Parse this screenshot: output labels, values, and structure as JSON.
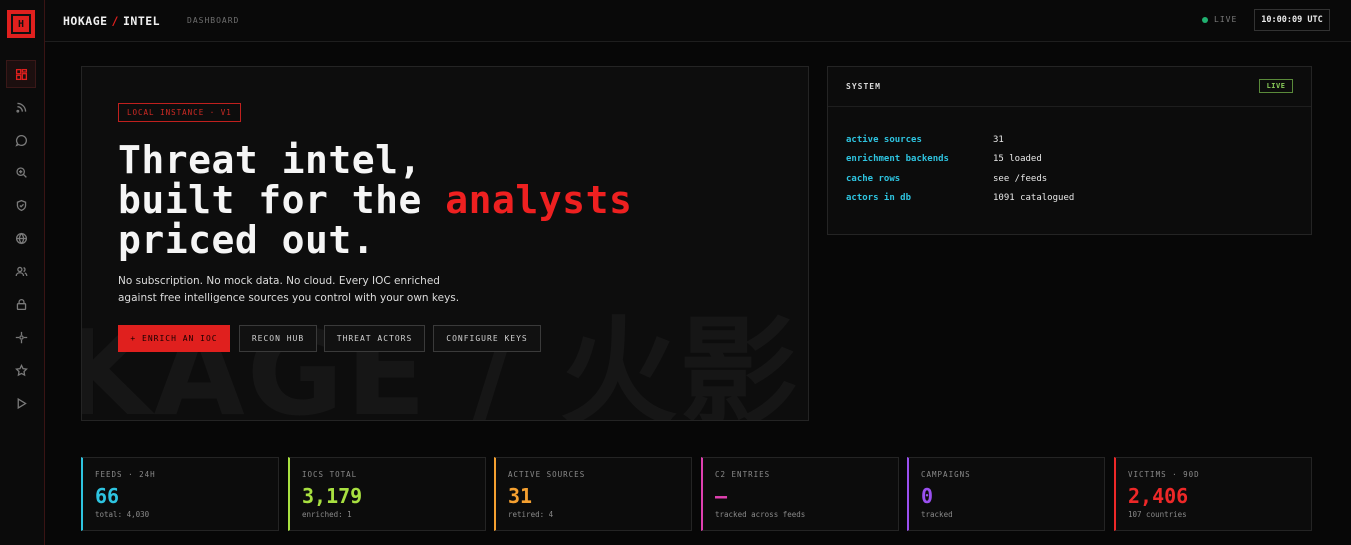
{
  "brand": {
    "logo_letter": "H",
    "left": "HOKAGE",
    "sep": "/",
    "right": "INTEL"
  },
  "breadcrumb": "DASHBOARD",
  "status": {
    "live_label": "LIVE",
    "clock": "10:00:09 UTC"
  },
  "sidebar": {
    "items": [
      {
        "icon": "dashboard-icon",
        "active": true
      },
      {
        "icon": "rss-feed-icon"
      },
      {
        "icon": "chat-bubble-icon"
      },
      {
        "icon": "search-zoom-icon"
      },
      {
        "icon": "shield-check-icon"
      },
      {
        "icon": "globe-icon"
      },
      {
        "icon": "users-icon"
      },
      {
        "icon": "lock-icon"
      },
      {
        "icon": "crosshair-icon"
      },
      {
        "icon": "star-icon"
      },
      {
        "icon": "play-icon"
      }
    ]
  },
  "hero": {
    "badge": "LOCAL INSTANCE · V1",
    "title_line1": "Threat intel,",
    "title_line2_pre": "built for the ",
    "title_line2_accent": "analysts",
    "title_line3": "priced out.",
    "description": "No subscription. No mock data. No cloud. Every IOC enriched against free intelligence sources you control with your own keys.",
    "watermark": "KAGE / 火影",
    "buttons": {
      "enrich": "+ ENRICH AN IOC",
      "recon": "RECON HUB",
      "actors": "THREAT ACTORS",
      "keys": "CONFIGURE KEYS"
    }
  },
  "system": {
    "title": "SYSTEM",
    "badge": "LIVE",
    "rows": [
      {
        "key": "active sources",
        "value": "31"
      },
      {
        "key": "enrichment backends",
        "value": "15 loaded"
      },
      {
        "key": "cache rows",
        "value": "see /feeds"
      },
      {
        "key": "actors in db",
        "value": "1091 catalogued"
      }
    ]
  },
  "stats": [
    {
      "label": "FEEDS · 24H",
      "value": "66",
      "sub": "total: 4,030",
      "color": "#2ec4e0"
    },
    {
      "label": "IOCS TOTAL",
      "value": "3,179",
      "sub": "enriched: 1",
      "color": "#a8e040"
    },
    {
      "label": "ACTIVE SOURCES",
      "value": "31",
      "sub": "retired: 4",
      "color": "#f5a030"
    },
    {
      "label": "C2 ENTRIES",
      "value": "—",
      "sub": "tracked across feeds",
      "color": "#e040b0"
    },
    {
      "label": "CAMPAIGNS",
      "value": "0",
      "sub": "tracked",
      "color": "#9a50f0"
    },
    {
      "label": "VICTIMS · 90D",
      "value": "2,406",
      "sub": "107 countries",
      "color": "#ee2828"
    }
  ]
}
